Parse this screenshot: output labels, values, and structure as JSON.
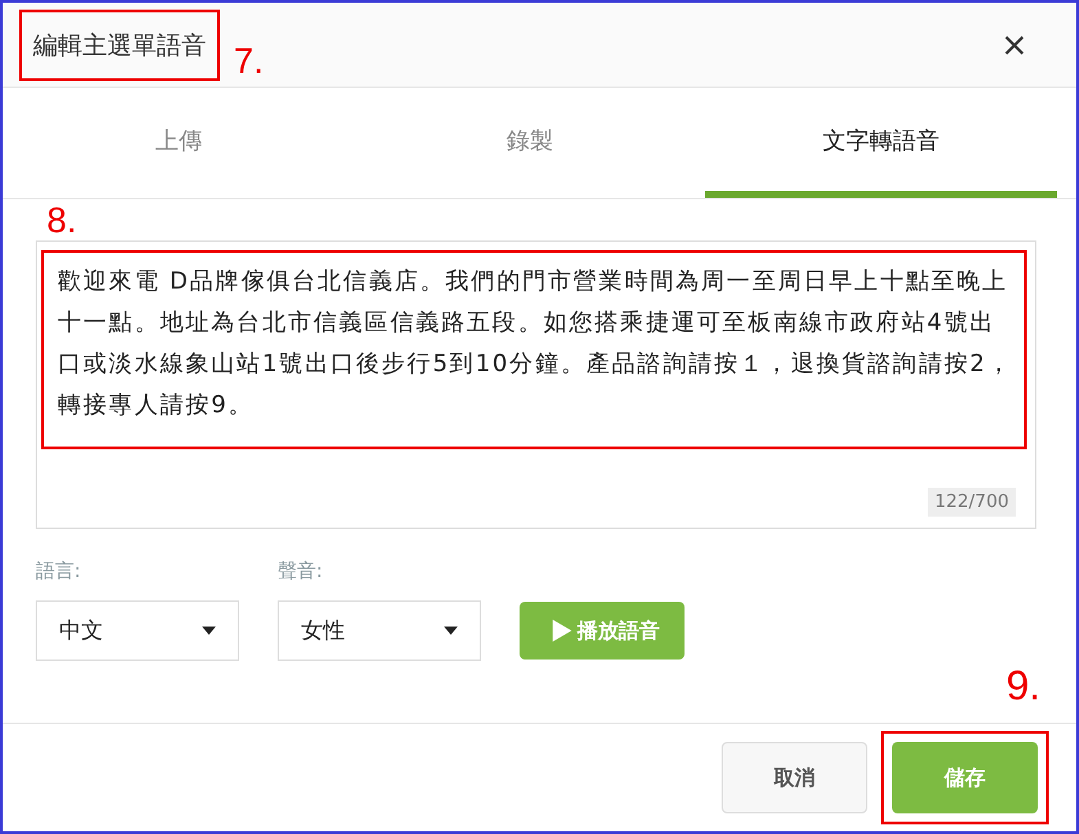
{
  "dialog": {
    "title": "編輯主選單語音",
    "title_highlighted": true,
    "title_annotation": "7."
  },
  "tabs": [
    {
      "label": "上傳",
      "selected": false
    },
    {
      "label": "錄製",
      "selected": false
    },
    {
      "label": "文字轉語音",
      "selected": true
    }
  ],
  "tts": {
    "annotation": "8.",
    "text": "歡迎來電 D品牌傢俱台北信義店。我們的門市營業時間為周一至周日早上十點至晚上十一點。地址為台北市信義區信義路五段。如您搭乘捷運可至板南線市政府站4號出口或淡水線象山站1號出口後步行5到10分鐘。產品諮詢請按１，退換貨諮詢請按2，轉接專人請按9。",
    "text_highlighted": true,
    "counter": "122/700"
  },
  "selects": [
    {
      "label": "語言:",
      "value": "中文"
    },
    {
      "label": "聲音:",
      "value": "女性"
    }
  ],
  "play_button": "播放語音",
  "footer": {
    "annotation": "9.",
    "buttons": [
      {
        "label": "取消",
        "kind": "secondary",
        "highlighted": false
      },
      {
        "label": "儲存",
        "kind": "primary",
        "highlighted": true
      }
    ]
  }
}
